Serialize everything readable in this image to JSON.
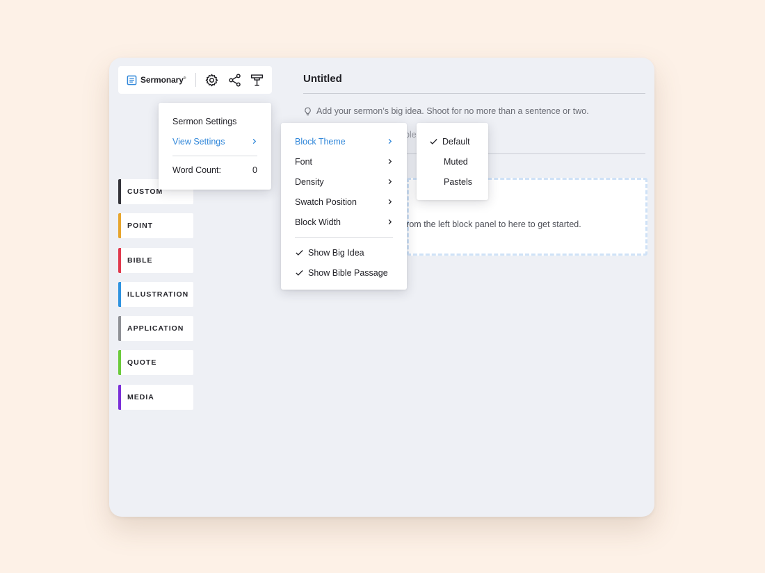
{
  "app": {
    "logo_text": "Sermonary",
    "logo_mark": "®"
  },
  "toolbar": {
    "settings_icon": "gear-icon",
    "share_icon": "share-icon",
    "present_icon": "lamp-icon"
  },
  "block_panel": {
    "items": [
      {
        "label": "CUSTOM",
        "color": "#34343a"
      },
      {
        "label": "POINT",
        "color": "#e7a52d"
      },
      {
        "label": "BIBLE",
        "color": "#e03a4e"
      },
      {
        "label": "ILLUSTRATION",
        "color": "#2f93e0"
      },
      {
        "label": "APPLICATION",
        "color": "#8f9196"
      },
      {
        "label": "QUOTE",
        "color": "#6ccb3c"
      },
      {
        "label": "MEDIA",
        "color": "#7b2fd8"
      }
    ]
  },
  "document": {
    "title": "Untitled",
    "big_idea_placeholder": "Add your sermon’s big idea. Shoot for no more than a sentence or two.",
    "bible_hint_fragment": "ble",
    "dropzone_text": "k from the left block panel to here to get started."
  },
  "settings_menu": {
    "sermon_settings": "Sermon Settings",
    "view_settings": "View Settings",
    "word_count_label": "Word Count:",
    "word_count_value": "0"
  },
  "view_menu": {
    "items": [
      "Block Theme",
      "Font",
      "Density",
      "Swatch Position",
      "Block Width"
    ],
    "toggles": [
      "Show Big Idea",
      "Show Bible Passage"
    ]
  },
  "theme_menu": {
    "options": [
      "Default",
      "Muted",
      "Pastels"
    ],
    "selected": "Default"
  },
  "colors": {
    "accent": "#2f86d9",
    "background": "#fdf1e7",
    "window": "#eef0f5"
  }
}
